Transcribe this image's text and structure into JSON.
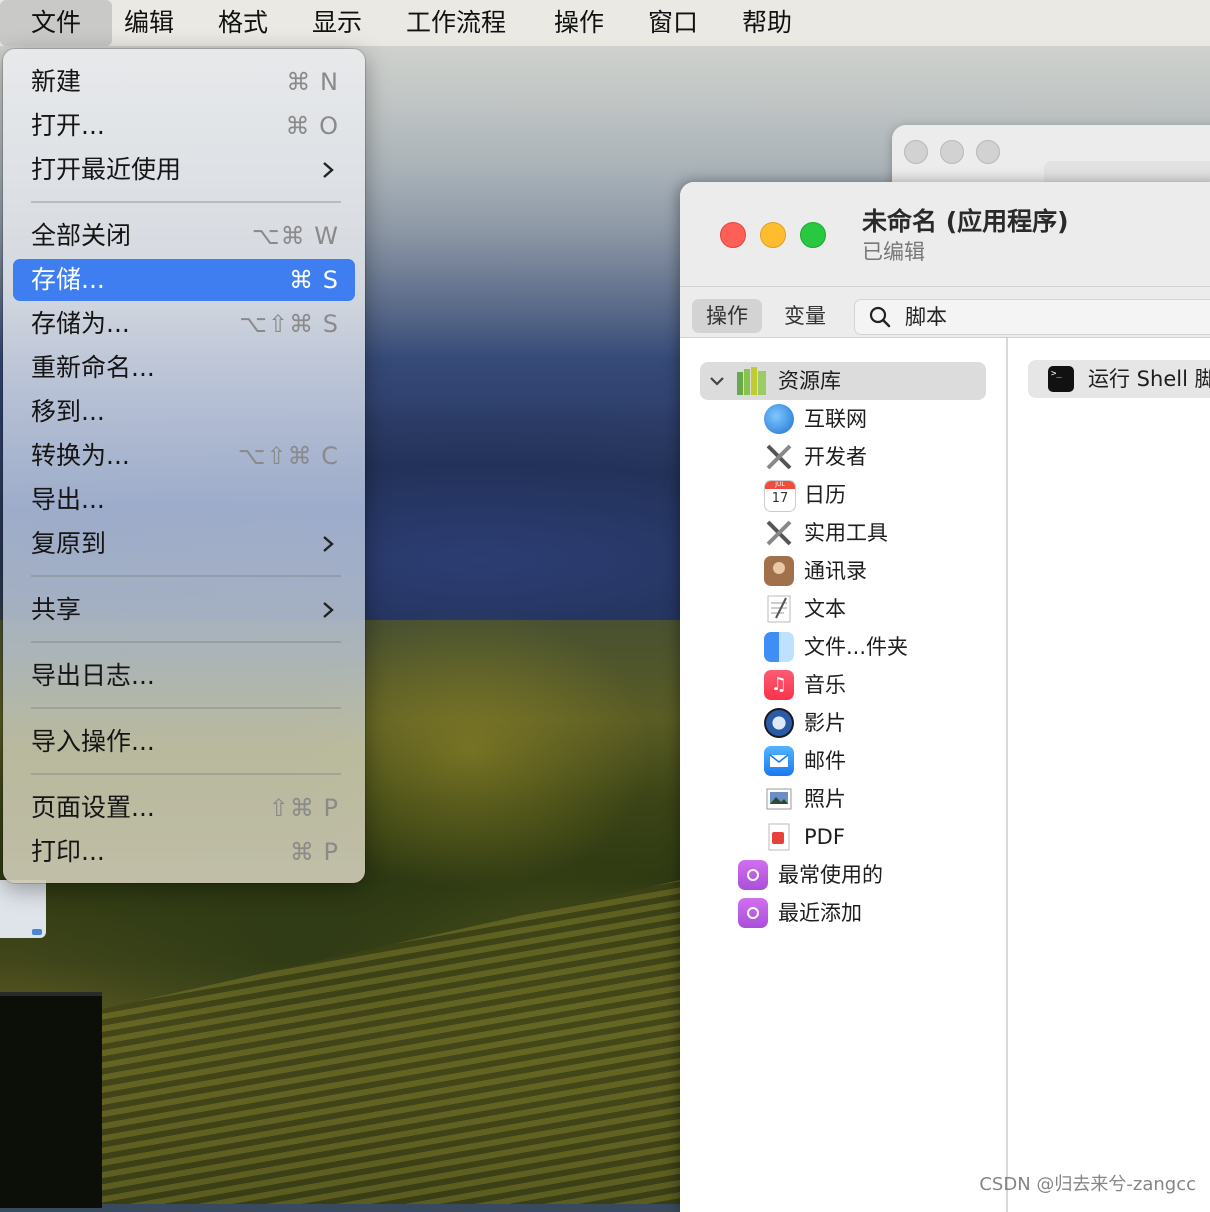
{
  "menubar": {
    "items": [
      "文件",
      "编辑",
      "格式",
      "显示",
      "工作流程",
      "操作",
      "窗口",
      "帮助"
    ]
  },
  "file_menu": {
    "new": {
      "label": "新建",
      "shortcut": "⌘ N"
    },
    "open": {
      "label": "打开...",
      "shortcut": "⌘ O"
    },
    "open_recent": {
      "label": "打开最近使用"
    },
    "close_all": {
      "label": "全部关闭",
      "shortcut": "⌥⌘ W"
    },
    "save": {
      "label": "存储...",
      "shortcut": "⌘ S"
    },
    "save_as": {
      "label": "存储为...",
      "shortcut": "⌥⇧⌘ S"
    },
    "rename": {
      "label": "重新命名..."
    },
    "move_to": {
      "label": "移到..."
    },
    "convert_to": {
      "label": "转换为...",
      "shortcut": "⌥⇧⌘ C"
    },
    "export": {
      "label": "导出..."
    },
    "revert_to": {
      "label": "复原到"
    },
    "share": {
      "label": "共享"
    },
    "export_log": {
      "label": "导出日志..."
    },
    "import_actions": {
      "label": "导入操作..."
    },
    "page_setup": {
      "label": "页面设置...",
      "shortcut": "⇧⌘ P"
    },
    "print": {
      "label": "打印...",
      "shortcut": "⌘ P"
    }
  },
  "window": {
    "title": "未命名 (应用程序)",
    "subtitle": "已编辑",
    "tabs": {
      "actions": "操作",
      "variables": "变量"
    },
    "search": {
      "value": "脚本"
    },
    "library": {
      "label": "资源库",
      "items": [
        {
          "label": "互联网",
          "icon": "globe-icon"
        },
        {
          "label": "开发者",
          "icon": "tools-icon"
        },
        {
          "label": "日历",
          "icon": "calendar-icon",
          "badge": "17",
          "month": "JUL"
        },
        {
          "label": "实用工具",
          "icon": "tools-icon"
        },
        {
          "label": "通讯录",
          "icon": "contacts-icon"
        },
        {
          "label": "文本",
          "icon": "text-icon"
        },
        {
          "label": "文件...件夹",
          "icon": "finder-icon"
        },
        {
          "label": "音乐",
          "icon": "music-icon"
        },
        {
          "label": "影片",
          "icon": "movie-icon"
        },
        {
          "label": "邮件",
          "icon": "mail-icon"
        },
        {
          "label": "照片",
          "icon": "photos-icon"
        },
        {
          "label": "PDF",
          "icon": "pdf-icon"
        }
      ],
      "groups": [
        {
          "label": "最常使用的",
          "icon": "smart-folder-icon"
        },
        {
          "label": "最近添加",
          "icon": "smart-folder-icon"
        }
      ]
    },
    "action_result": {
      "label": "运行 Shell 脚",
      "icon": "terminal-icon"
    }
  },
  "watermark": "CSDN @归去来兮-zangcc",
  "colors": {
    "selection": "#3f7ef0",
    "close": "#fe5f57",
    "minimize": "#febc2e",
    "zoom": "#28c840"
  }
}
